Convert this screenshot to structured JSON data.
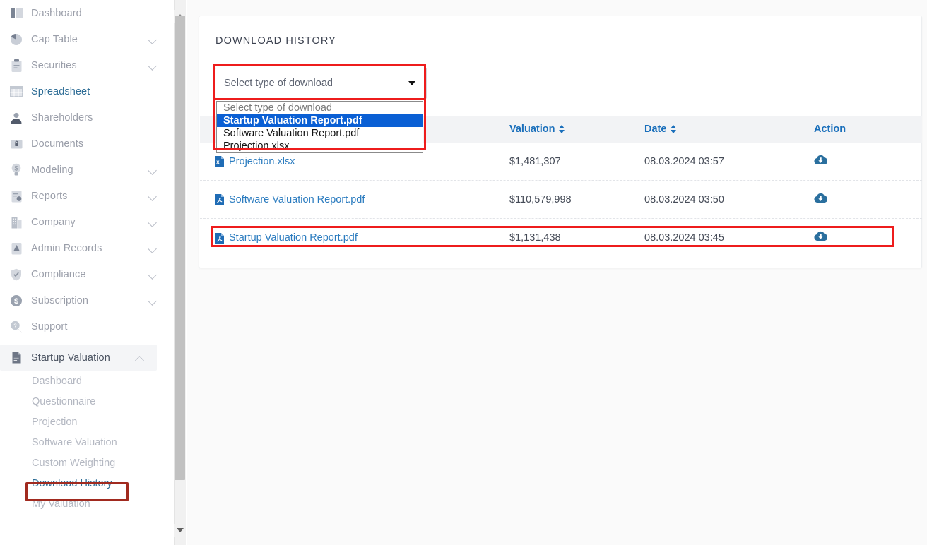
{
  "sidebar": {
    "items": [
      {
        "label": "Dashboard",
        "icon": "dashboard-icon",
        "expandable": false,
        "active": false
      },
      {
        "label": "Cap Table",
        "icon": "pie-chart-icon",
        "expandable": true,
        "active": false
      },
      {
        "label": "Securities",
        "icon": "clipboard-icon",
        "expandable": true,
        "active": false
      },
      {
        "label": "Spreadsheet",
        "icon": "table-grid-icon",
        "expandable": false,
        "active": true
      },
      {
        "label": "Shareholders",
        "icon": "user-icon",
        "expandable": false,
        "active": false
      },
      {
        "label": "Documents",
        "icon": "lock-folder-icon",
        "expandable": false,
        "active": false
      },
      {
        "label": "Modeling",
        "icon": "lightbulb-icon",
        "expandable": true,
        "active": false
      },
      {
        "label": "Reports",
        "icon": "report-icon",
        "expandable": true,
        "active": false
      },
      {
        "label": "Company",
        "icon": "building-icon",
        "expandable": true,
        "active": false
      },
      {
        "label": "Admin Records",
        "icon": "admin-records-icon",
        "expandable": true,
        "active": false
      },
      {
        "label": "Compliance",
        "icon": "shield-check-icon",
        "expandable": true,
        "active": false
      },
      {
        "label": "Subscription",
        "icon": "dollar-circle-icon",
        "expandable": true,
        "active": false
      },
      {
        "label": "Support",
        "icon": "support-chat-icon",
        "expandable": false,
        "active": false
      }
    ],
    "group": {
      "label": "Startup Valuation",
      "icon": "document-icon",
      "expanded": true,
      "sub_items": [
        {
          "label": "Dashboard",
          "active": false,
          "highlighted": false
        },
        {
          "label": "Questionnaire",
          "active": false,
          "highlighted": false
        },
        {
          "label": "Projection",
          "active": false,
          "highlighted": false
        },
        {
          "label": "Software Valuation",
          "active": false,
          "highlighted": false
        },
        {
          "label": "Custom Weighting",
          "active": false,
          "highlighted": false
        },
        {
          "label": "Download History",
          "active": true,
          "highlighted": true
        },
        {
          "label": "My Valuation",
          "active": false,
          "highlighted": false
        }
      ]
    }
  },
  "main": {
    "card_title": "DOWNLOAD HISTORY",
    "select": {
      "placeholder": "Select type of download",
      "value": "Select type of download",
      "open": true,
      "highlighted": true,
      "options": [
        {
          "label": "Select type of download",
          "selected": false,
          "is_placeholder": true
        },
        {
          "label": "Startup Valuation Report.pdf",
          "selected": true,
          "is_placeholder": false
        },
        {
          "label": "Software Valuation Report.pdf",
          "selected": false,
          "is_placeholder": false
        },
        {
          "label": "Projection.xlsx",
          "selected": false,
          "is_placeholder": false
        }
      ]
    },
    "table": {
      "columns": [
        {
          "label": "",
          "sortable": false
        },
        {
          "label": "Valuation",
          "sortable": true
        },
        {
          "label": "Date",
          "sortable": true
        },
        {
          "label": "Action",
          "sortable": false
        }
      ],
      "rows": [
        {
          "file_name": "Projection.xlsx",
          "file_type": "xlsx",
          "valuation": "$1,481,307",
          "date": "08.03.2024 03:57",
          "action": "download-cloud-icon",
          "highlighted": false
        },
        {
          "file_name": "Software Valuation Report.pdf",
          "file_type": "pdf",
          "valuation": "$110,579,998",
          "date": "08.03.2024 03:50",
          "action": "download-cloud-icon",
          "highlighted": false
        },
        {
          "file_name": "Startup Valuation Report.pdf",
          "file_type": "pdf",
          "valuation": "$1,131,438",
          "date": "08.03.2024 03:45",
          "action": "download-cloud-icon",
          "highlighted": true
        }
      ]
    }
  },
  "colors": {
    "link": "#2a7bbf",
    "header_link": "#1a6fbb",
    "highlight_red": "#ee1c1c",
    "sidebar_highlight_red": "#a12a1f",
    "dropdown_selected_bg": "#0a5fd4",
    "muted_text": "#9b9faa"
  }
}
